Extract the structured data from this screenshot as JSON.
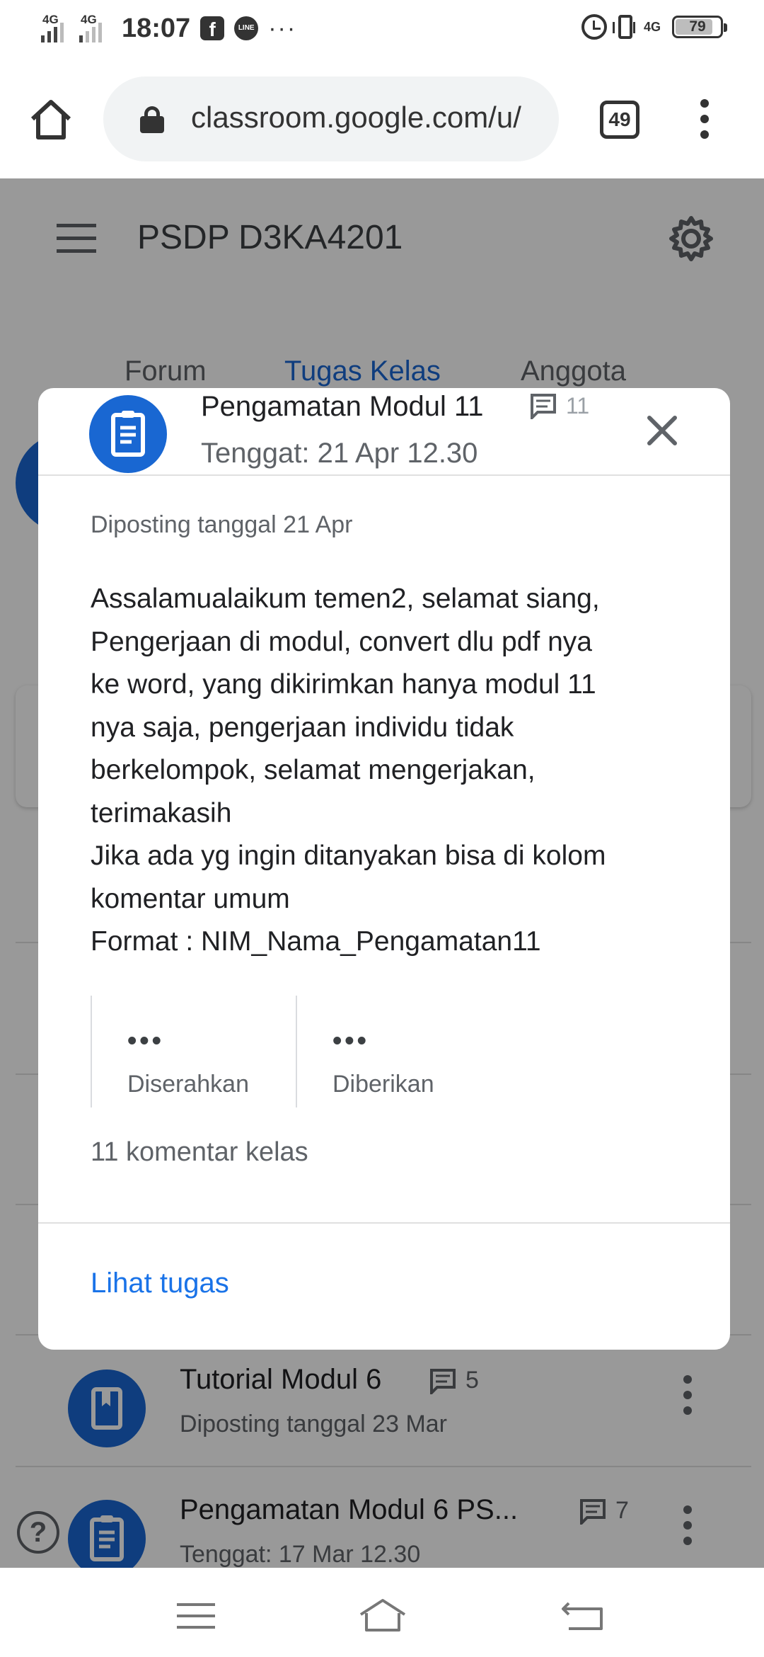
{
  "status_bar": {
    "signal_1": "4G",
    "signal_2": "4G",
    "time": "18:07",
    "more": "···",
    "network_right": "4G",
    "battery": "79"
  },
  "browser": {
    "url": "classroom.google.com/u/",
    "tab_count": "49"
  },
  "classroom": {
    "class_name": "PSDP D3KA4201",
    "tabs": [
      "Forum",
      "Tugas Kelas",
      "Anggota"
    ],
    "active_tab": "Tugas Kelas",
    "items": [
      {
        "title": "Tutorial Modul 6",
        "comments": "5",
        "subtitle": "Diposting tanggal 23 Mar",
        "icon": "book-icon"
      },
      {
        "title": "Pengamatan Modul 6 PS...",
        "comments": "7",
        "subtitle": "Tenggat: 17 Mar 12.30",
        "icon": "assignment-icon"
      }
    ]
  },
  "dialog": {
    "title": "Pengamatan Modul 11",
    "comment_count": "11",
    "due": "Tenggat: 21 Apr 12.30",
    "posted": "Diposting tanggal 21 Apr",
    "body_lines": [
      "Assalamualaikum temen2, selamat siang,",
      "Pengerjaan di modul, convert dlu pdf nya",
      "ke word, yang dikirimkan hanya modul 11",
      "nya saja, pengerjaan individu tidak",
      "berkelompok, selamat mengerjakan,",
      "terimakasih",
      "Jika ada yg ingin ditanyakan bisa di kolom",
      "komentar umum",
      "Format : NIM_Nama_Pengamatan11"
    ],
    "stats": [
      {
        "value": "•••",
        "label": "Diserahkan"
      },
      {
        "value": "•••",
        "label": "Diberikan"
      }
    ],
    "class_comments": "11 komentar kelas",
    "action": "Lihat tugas"
  },
  "colors": {
    "accent": "#1967d2",
    "link": "#1a73e8",
    "scrim": "rgba(0,0,0,0.40)"
  }
}
